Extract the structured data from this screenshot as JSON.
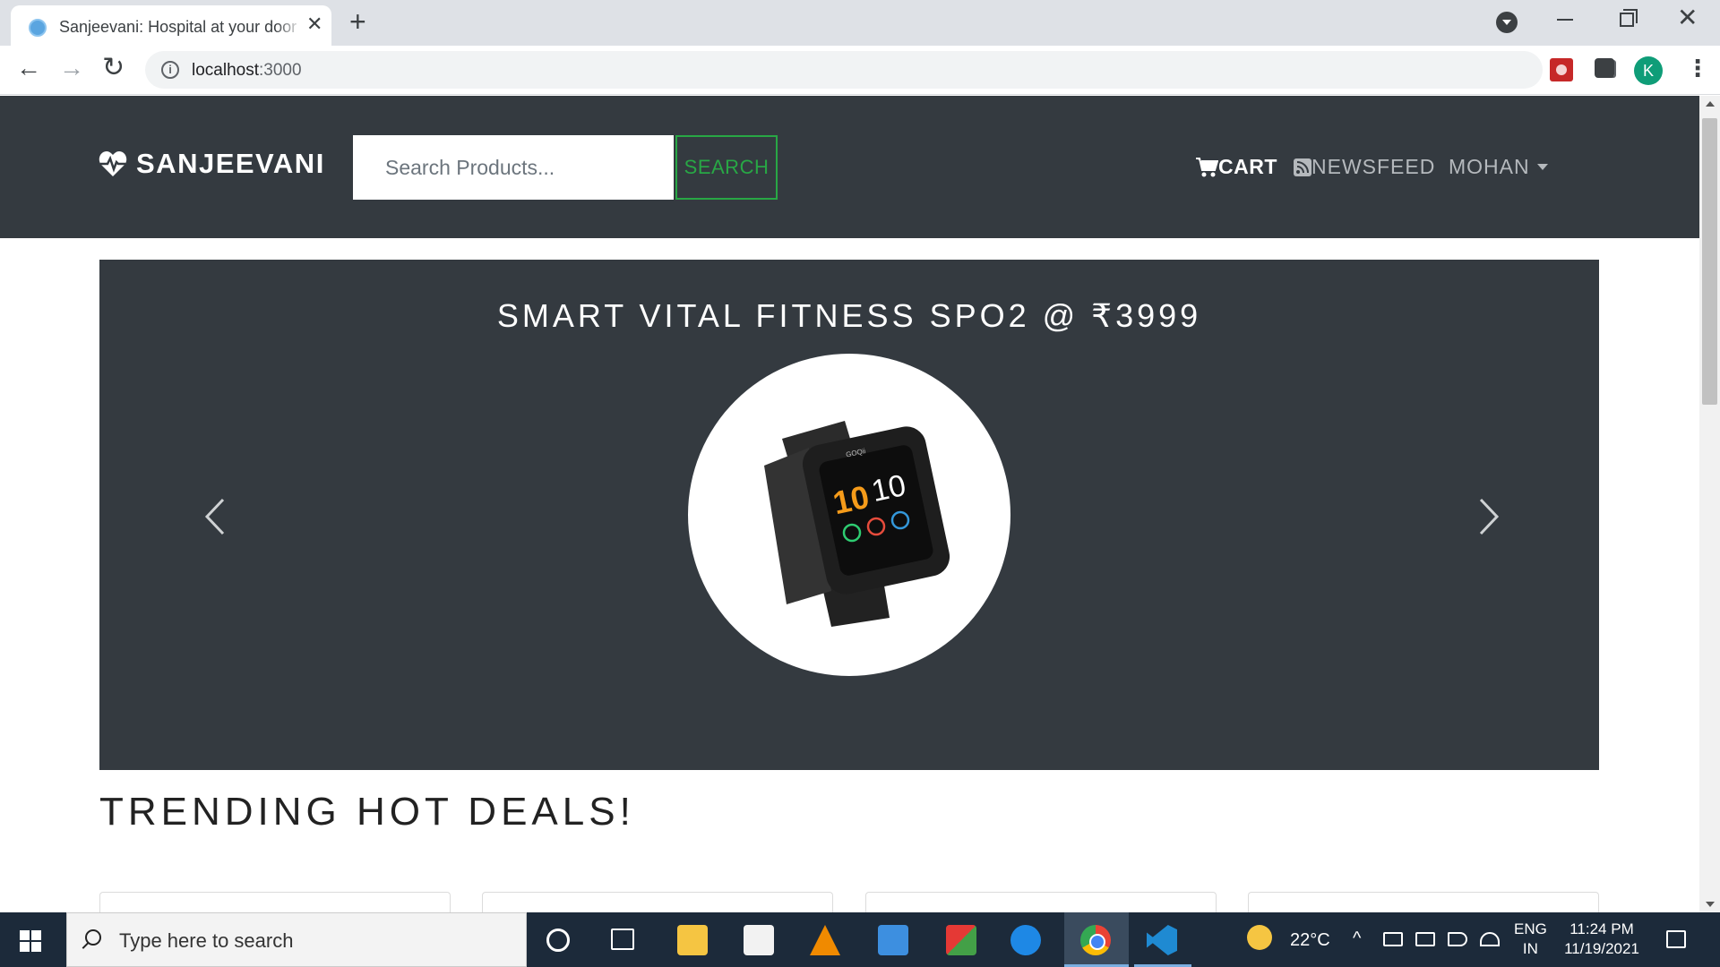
{
  "browser": {
    "tab_title": "Sanjeevani: Hospital at your door",
    "tab_close": "✕",
    "new_tab": "+",
    "url_host": "localhost",
    "url_port": ":3000",
    "avatar_letter": "K"
  },
  "header": {
    "brand": "SANJEEVANI",
    "search_placeholder": "Search Products...",
    "search_button": "SEARCH",
    "nav_cart": "CART",
    "nav_newsfeed": "NEWSFEED",
    "nav_user": "MOHAN"
  },
  "carousel": {
    "slide_title": "SMART VITAL FITNESS SPO2 @ ₹3999",
    "watch_time_hour": "10",
    "watch_time_min": "10",
    "watch_brand": "GOQii"
  },
  "section": {
    "title": "TRENDING HOT DEALS!"
  },
  "taskbar": {
    "search_placeholder": "Type here to search",
    "weather": "22°C",
    "lang_1": "ENG",
    "lang_2": "IN",
    "time": "11:24 PM",
    "date": "11/19/2021"
  },
  "colors": {
    "header_bg": "#343a40",
    "accent_green": "#28a745",
    "taskbar_bg": "#1c2a3a"
  }
}
